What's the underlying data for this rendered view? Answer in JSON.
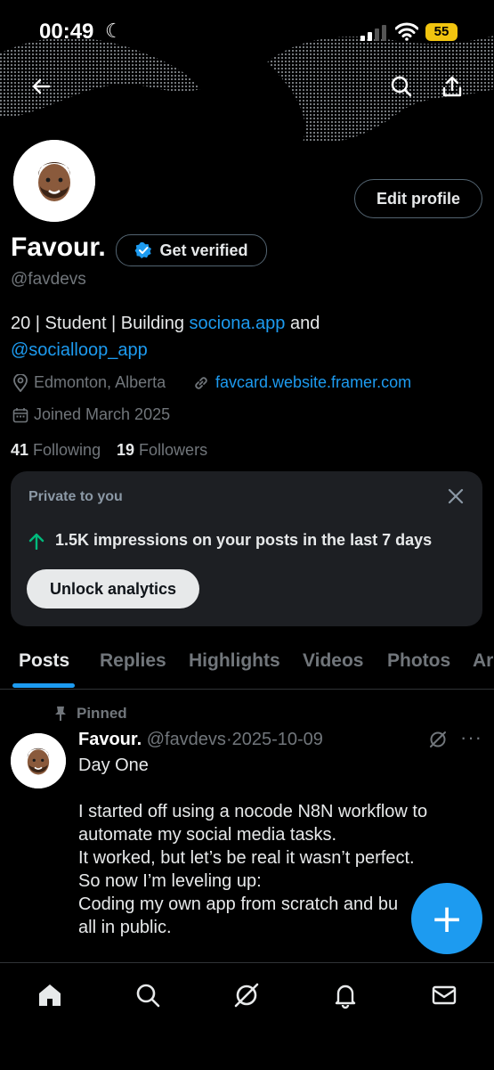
{
  "status_bar": {
    "time": "00:49",
    "battery": "55"
  },
  "profile": {
    "name": "Favour.",
    "get_verified_label": "Get verified",
    "handle": "@favdevs",
    "edit_profile_label": "Edit profile",
    "bio_prefix": "20 | Student | Building ",
    "bio_link1": "sociona.app",
    "bio_middle": " and",
    "bio_link2": "@socialloop_app",
    "location": "Edmonton, Alberta",
    "website": "favcard.website.framer.com",
    "joined": "Joined March 2025",
    "following_count": "41",
    "following_label": "Following",
    "followers_count": "19",
    "followers_label": "Followers"
  },
  "analytics_card": {
    "title": "Private to you",
    "impressions_text": "1.5K impressions on your posts in the last 7 days",
    "unlock_label": "Unlock analytics"
  },
  "tabs": [
    {
      "label": "Posts"
    },
    {
      "label": "Replies"
    },
    {
      "label": "Highlights"
    },
    {
      "label": "Videos"
    },
    {
      "label": "Photos"
    },
    {
      "label": "Ar"
    }
  ],
  "pinned_post": {
    "pinned_label": "Pinned",
    "author_name": "Favour.",
    "author_handle": "@favdevs",
    "separator": "·",
    "date": "2025-10-09",
    "text": "Day One\n\nI started off using a nocode N8N workflow to automate my social media tasks.\nIt worked, but let’s be real it wasn’t perfect.\nSo now I’m leveling up:\nCoding my own app from scratch and bu\nall in public."
  },
  "fab": {
    "label": "+"
  },
  "colors": {
    "accent": "#1d9bf0",
    "background": "#000000",
    "card": "#1d1f23",
    "muted": "#71767b",
    "up_arrow": "#00ba7c"
  }
}
